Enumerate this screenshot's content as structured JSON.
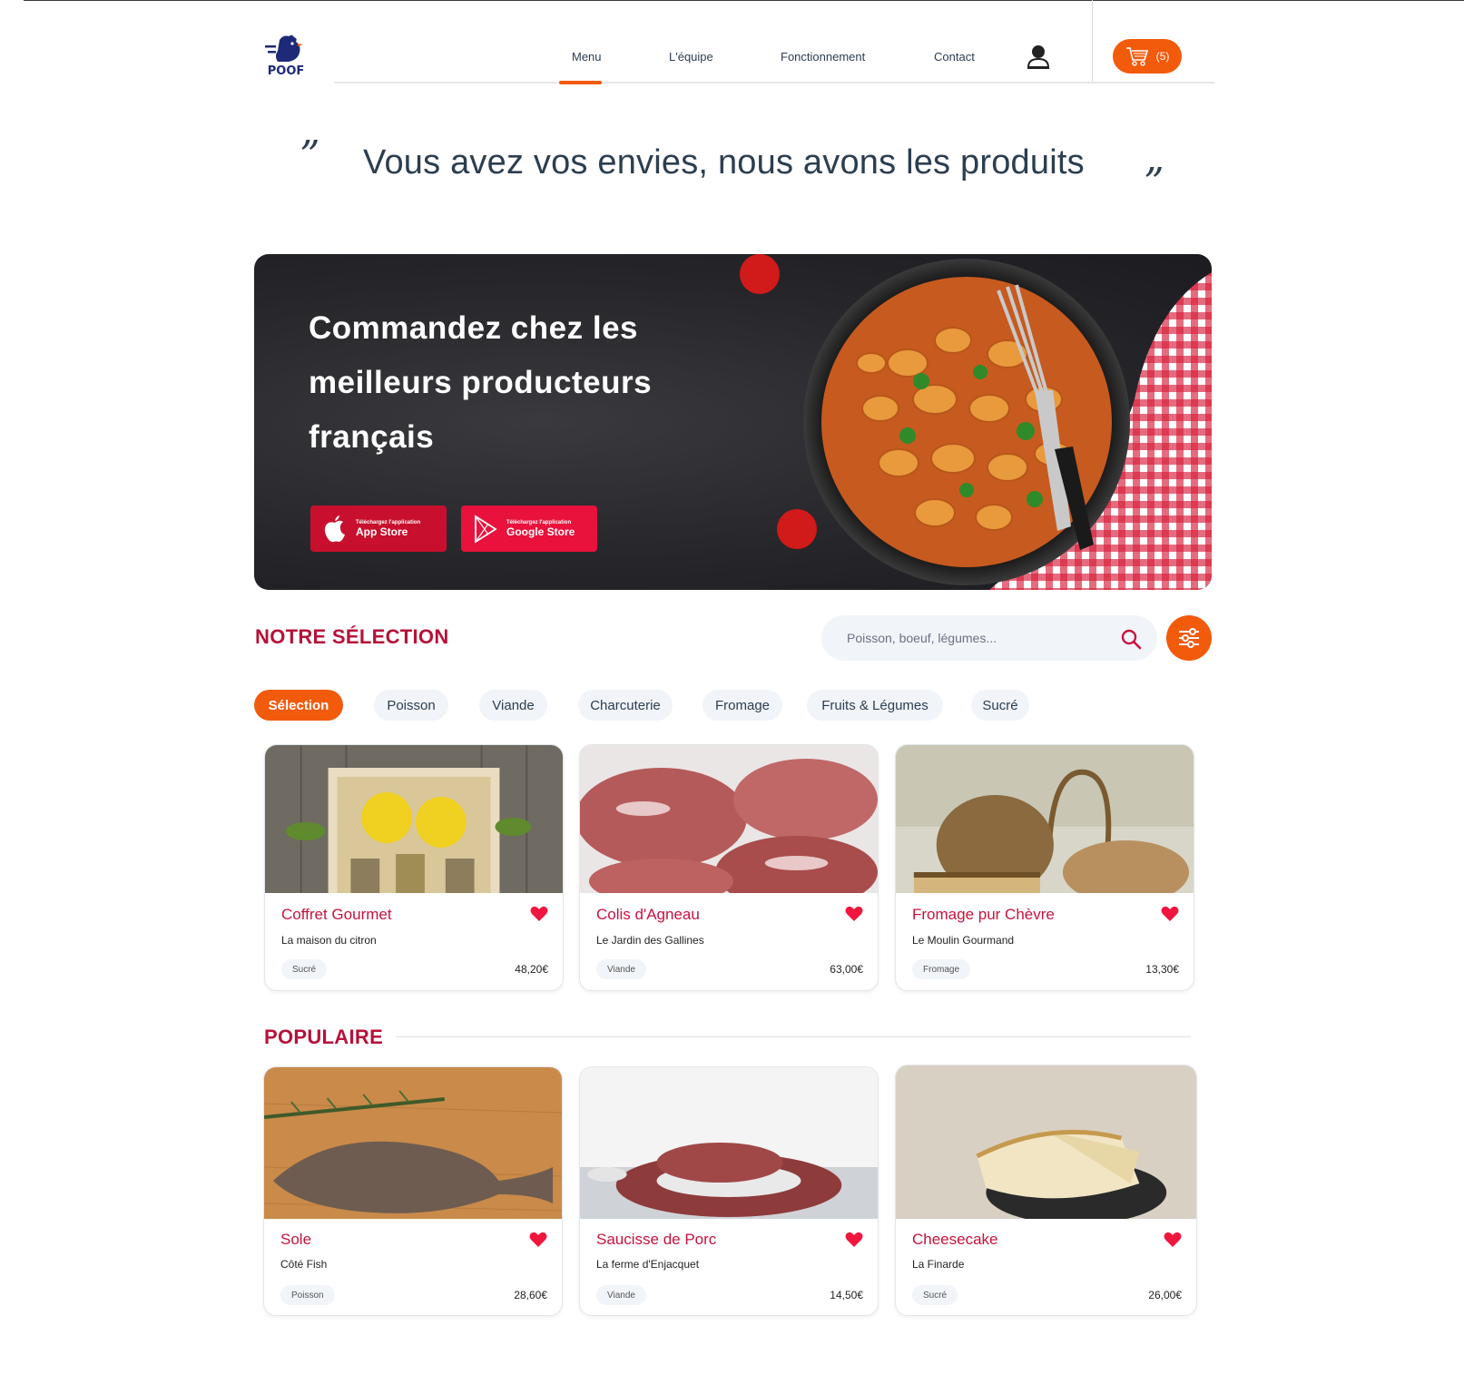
{
  "brand": {
    "logo_text": "POOF",
    "accent": "#f25a0c",
    "brand_red": "#c8123e",
    "navy": "#1e2a78"
  },
  "nav": {
    "items": [
      {
        "label": "Menu",
        "active": true
      },
      {
        "label": "L'équipe",
        "active": false
      },
      {
        "label": "Fonctionnement",
        "active": false
      },
      {
        "label": "Contact",
        "active": false
      }
    ],
    "user_icon": "user-icon",
    "cart": {
      "icon": "cart-icon",
      "count_label": "(5)"
    }
  },
  "headline": {
    "open_quote": "”",
    "text": "Vous avez vos envies, nous avons les produits",
    "close_quote": "”"
  },
  "hero": {
    "title": "Commandez chez les meilleurs producteurs français",
    "app_store": {
      "small": "Téléchargez l'application",
      "big": "App Store"
    },
    "google_store": {
      "small": "Téléchargez l'application",
      "big": "Google Store"
    }
  },
  "selection": {
    "title": "NOTRE SÉLECTION",
    "search_placeholder": "Poisson, boeuf, légumes...",
    "categories": [
      {
        "label": "Sélection",
        "active": true
      },
      {
        "label": "Poisson",
        "active": false
      },
      {
        "label": "Viande",
        "active": false
      },
      {
        "label": "Charcuterie",
        "active": false
      },
      {
        "label": "Fromage",
        "active": false
      },
      {
        "label": "Fruits & Légumes",
        "active": false
      },
      {
        "label": "Sucré",
        "active": false
      }
    ],
    "products": [
      {
        "name": "Coffret Gourmet",
        "producer": "La maison du citron",
        "tag": "Sucré",
        "price": "48,20€",
        "image": "lemon-gift-box"
      },
      {
        "name": "Colis d'Agneau",
        "producer": "Le Jardin des Gallines",
        "tag": "Viande",
        "price": "63,00€",
        "image": "lamb-cuts"
      },
      {
        "name": "Fromage pur Chèvre",
        "producer": "Le Moulin Gourmand",
        "tag": "Fromage",
        "price": "13,30€",
        "image": "goat-cheese"
      }
    ]
  },
  "popular": {
    "title": "POPULAIRE",
    "products": [
      {
        "name": "Sole",
        "producer": "Côté Fish",
        "tag": "Poisson",
        "price": "28,60€",
        "image": "sole-fish"
      },
      {
        "name": "Saucisse de Porc",
        "producer": "La ferme d'Enjacquet",
        "tag": "Viande",
        "price": "14,50€",
        "image": "pork-sausage"
      },
      {
        "name": "Cheesecake",
        "producer": "La Finarde",
        "tag": "Sucré",
        "price": "26,00€",
        "image": "cheesecake"
      }
    ]
  }
}
